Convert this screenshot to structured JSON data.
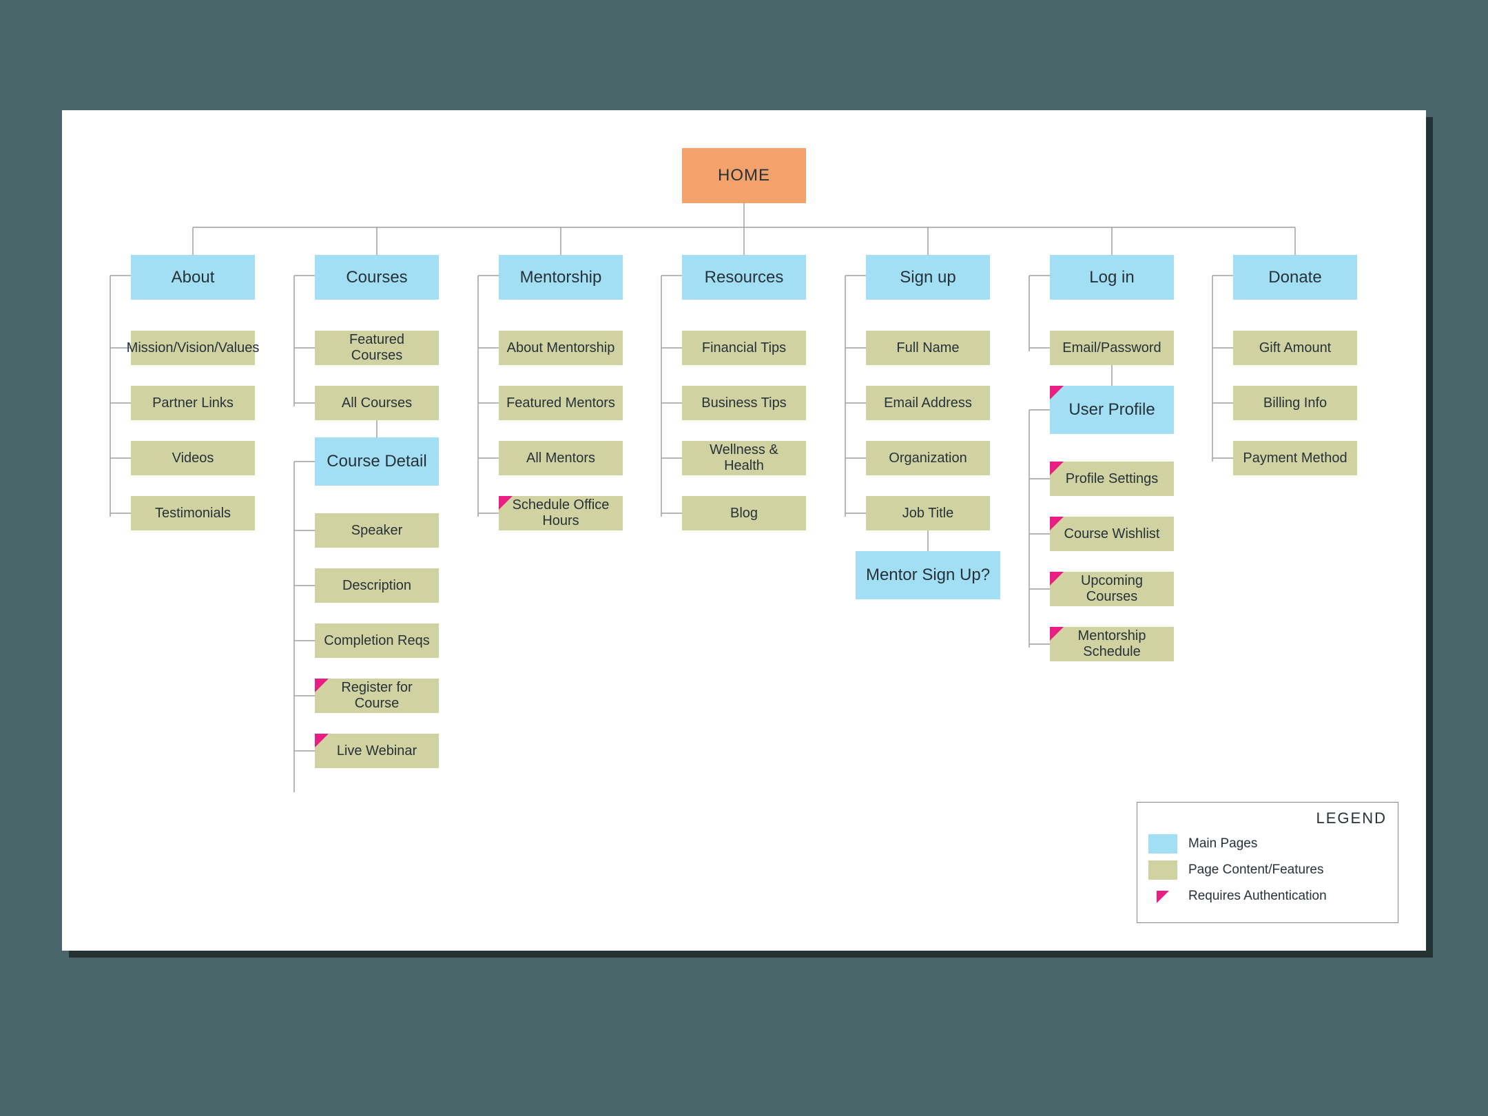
{
  "root": {
    "label": "HOME"
  },
  "columns": [
    {
      "title": "About",
      "children": [
        {
          "label": "Mission/Vision/Values",
          "auth": false
        },
        {
          "label": "Partner Links",
          "auth": false
        },
        {
          "label": "Videos",
          "auth": false
        },
        {
          "label": "Testimonials",
          "auth": false
        }
      ]
    },
    {
      "title": "Courses",
      "children": [
        {
          "label": "Featured Courses",
          "auth": false
        },
        {
          "label": "All Courses",
          "auth": false
        }
      ],
      "subpage": {
        "title": "Course Detail",
        "children": [
          {
            "label": "Speaker",
            "auth": false
          },
          {
            "label": "Description",
            "auth": false
          },
          {
            "label": "Completion Reqs",
            "auth": false
          },
          {
            "label": "Register for Course",
            "auth": true
          },
          {
            "label": "Live Webinar",
            "auth": true
          }
        ]
      }
    },
    {
      "title": "Mentorship",
      "children": [
        {
          "label": "About Mentorship",
          "auth": false
        },
        {
          "label": "Featured Mentors",
          "auth": false
        },
        {
          "label": "All Mentors",
          "auth": false
        },
        {
          "label": "Schedule Office Hours",
          "auth": true
        }
      ]
    },
    {
      "title": "Resources",
      "children": [
        {
          "label": "Financial Tips",
          "auth": false
        },
        {
          "label": "Business Tips",
          "auth": false
        },
        {
          "label": "Wellness & Health",
          "auth": false
        },
        {
          "label": "Blog",
          "auth": false
        }
      ]
    },
    {
      "title": "Sign up",
      "children": [
        {
          "label": "Full Name",
          "auth": false
        },
        {
          "label": "Email Address",
          "auth": false
        },
        {
          "label": "Organization",
          "auth": false
        },
        {
          "label": "Job Title",
          "auth": false
        }
      ],
      "subpage": {
        "title": "Mentor Sign Up?"
      }
    },
    {
      "title": "Log in",
      "children": [
        {
          "label": "Email/Password",
          "auth": false
        }
      ],
      "subpage": {
        "title": "User Profile",
        "auth": true,
        "children": [
          {
            "label": "Profile Settings",
            "auth": true
          },
          {
            "label": "Course Wishlist",
            "auth": true
          },
          {
            "label": "Upcoming Courses",
            "auth": true
          },
          {
            "label": "Mentorship Schedule",
            "auth": true
          }
        ]
      }
    },
    {
      "title": "Donate",
      "children": [
        {
          "label": "Gift Amount",
          "auth": false
        },
        {
          "label": "Billing Info",
          "auth": false
        },
        {
          "label": "Payment Method",
          "auth": false
        }
      ]
    }
  ],
  "legend": {
    "title": "LEGEND",
    "items": [
      {
        "label": "Main Pages"
      },
      {
        "label": "Page Content/Features"
      },
      {
        "label": "Requires Authentication"
      }
    ]
  }
}
